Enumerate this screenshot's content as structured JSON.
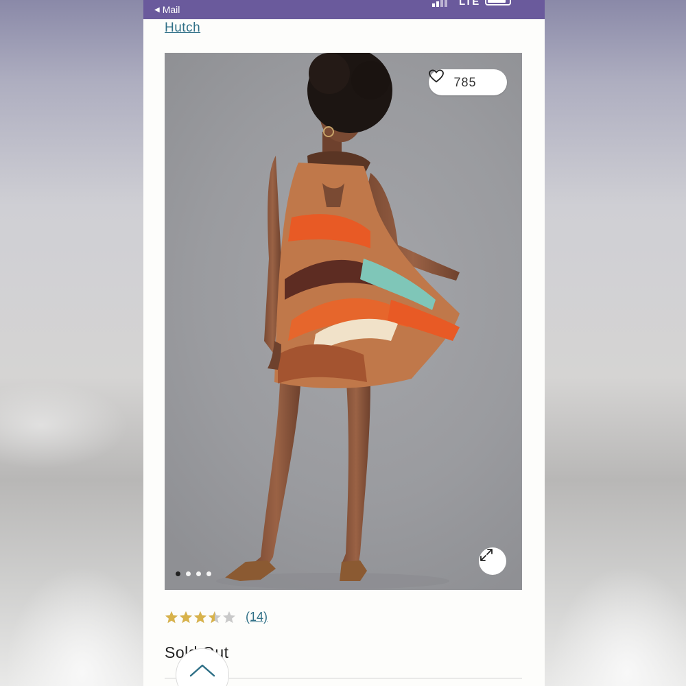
{
  "status_bar": {
    "back_label": "Mail",
    "network": "LTE",
    "color": "#6a5a9c"
  },
  "product": {
    "brand_link": "Hutch",
    "likes": "785",
    "image_count": 4,
    "active_image": 1,
    "rating": 3.5,
    "rating_max": 5,
    "review_count": "(14)",
    "availability": "Sold Out"
  },
  "colors": {
    "link": "#2e6f86",
    "star_filled": "#d8b24a",
    "star_empty": "#c9c9c9"
  },
  "icons": {
    "likes": "heart-icon",
    "expand": "expand-icon",
    "scroll_top": "chevron-up-icon",
    "back": "back-arrow-icon"
  }
}
